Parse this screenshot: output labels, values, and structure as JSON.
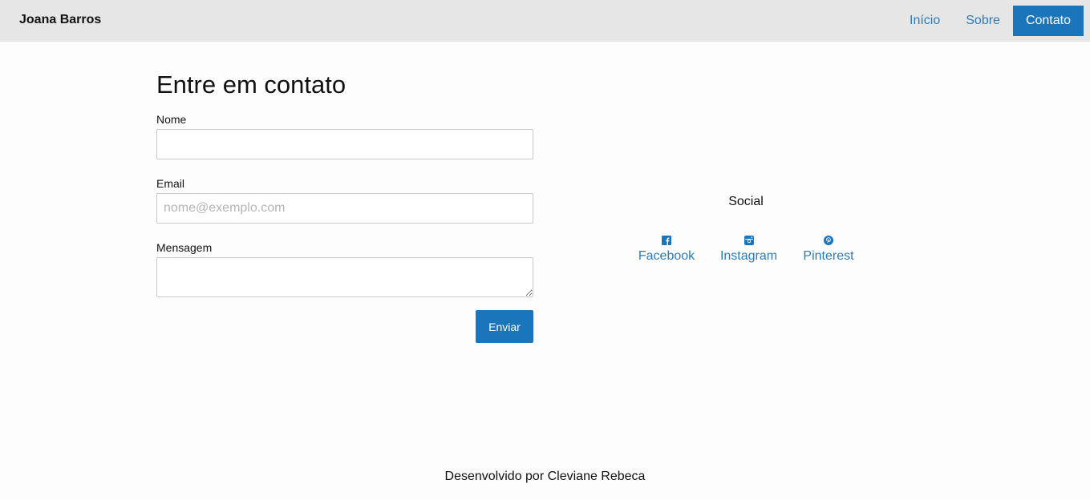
{
  "nav": {
    "brand": "Joana Barros",
    "links": [
      {
        "label": "Início",
        "active": false
      },
      {
        "label": "Sobre",
        "active": false
      },
      {
        "label": "Contato",
        "active": true
      }
    ]
  },
  "form": {
    "title": "Entre em contato",
    "name_label": "Nome",
    "name_value": "",
    "email_label": "Email",
    "email_placeholder": "nome@exemplo.com",
    "message_label": "Mensagem",
    "message_value": "",
    "submit_label": "Enviar"
  },
  "social": {
    "title": "Social",
    "links": [
      {
        "label": "Facebook",
        "icon": "facebook-icon"
      },
      {
        "label": "Instagram",
        "icon": "instagram-icon"
      },
      {
        "label": "Pinterest",
        "icon": "pinterest-icon"
      }
    ]
  },
  "footer": {
    "text": "Desenvolvido por Cleviane Rebeca"
  },
  "colors": {
    "accent": "#1b75bb",
    "link": "#2d7ab8",
    "navbar_bg": "#e6e6e6"
  }
}
